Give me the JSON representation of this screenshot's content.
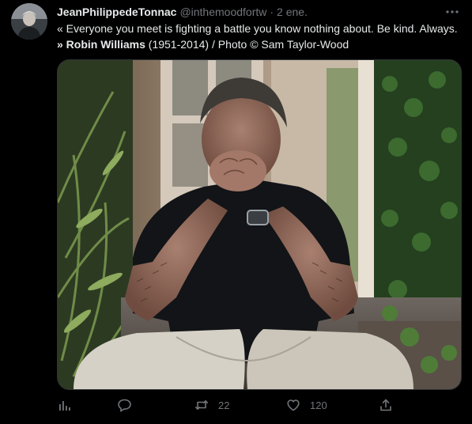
{
  "tweet": {
    "author": {
      "display_name": "JeanPhilippedeTonnac",
      "handle": "@inthemoodfortw",
      "separator": "·",
      "date": "2 ene."
    },
    "more_icon": "ellipsis-icon",
    "text": {
      "line1": "« Everyone you meet is fighting a battle you know nothing about. Be kind. Always.",
      "line2_bold": "» Robin Williams",
      "line2_rest": " (1951-2014) / Photo © Sam Taylor-Wood"
    },
    "actions": {
      "analytics": {
        "icon": "analytics-icon"
      },
      "reply": {
        "icon": "reply-icon"
      },
      "retweet": {
        "icon": "retweet-icon",
        "count": "22"
      },
      "like": {
        "icon": "heart-icon",
        "count": "120"
      },
      "share": {
        "icon": "share-icon"
      }
    }
  },
  "colors": {
    "background": "#000000",
    "text_primary": "#e7e9ea",
    "text_secondary": "#71767b"
  }
}
